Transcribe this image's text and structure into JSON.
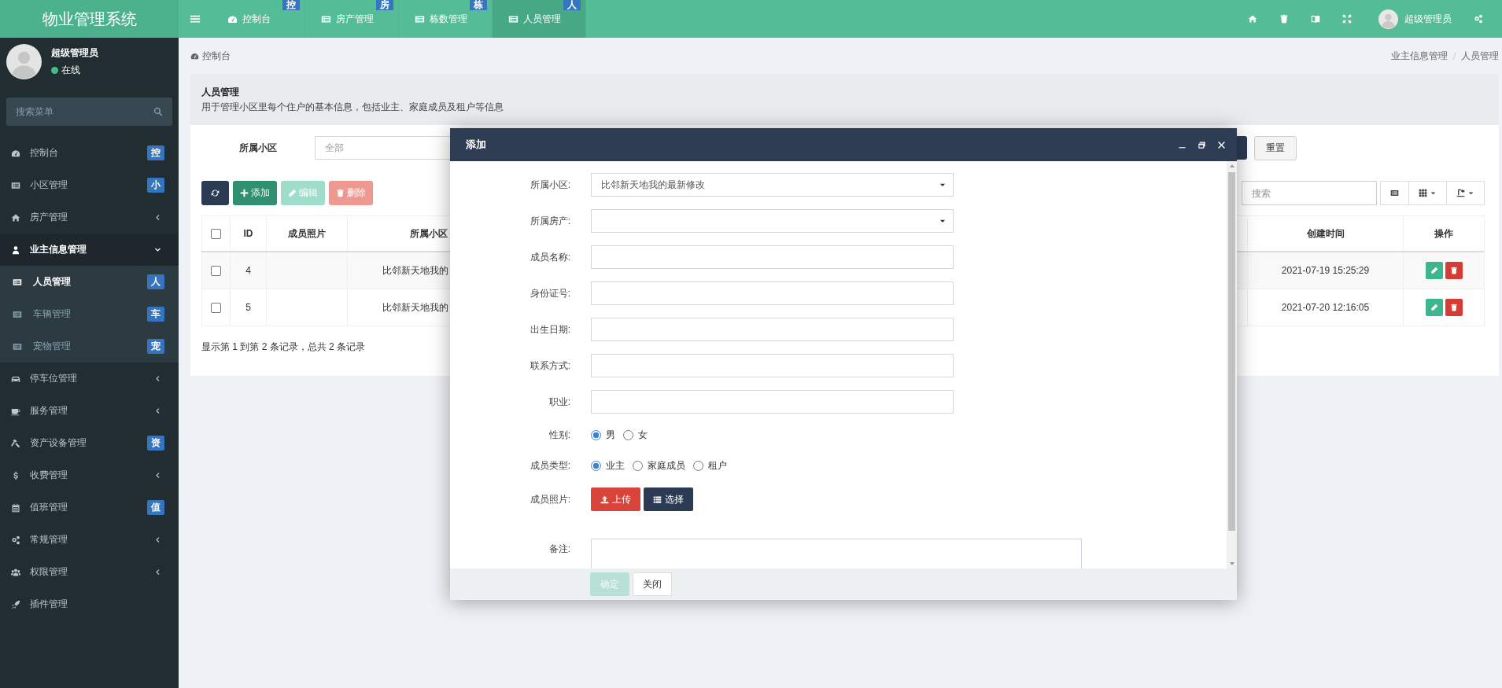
{
  "header": {
    "app_title": "物业管理系统",
    "tabs": [
      {
        "label": "控制台",
        "badge": "控",
        "selected": false
      },
      {
        "label": "房产管理",
        "badge": "房",
        "selected": false
      },
      {
        "label": "栋数管理",
        "badge": "栋",
        "selected": false
      },
      {
        "label": "人员管理",
        "badge": "人",
        "selected": true
      }
    ],
    "user_name": "超级管理员"
  },
  "sidebar": {
    "user": {
      "name": "超级管理员",
      "status": "在线"
    },
    "search": {
      "placeholder": "搜索菜单"
    },
    "items": [
      {
        "label": "控制台",
        "kind": "badge",
        "badge": "控",
        "selected": false
      },
      {
        "label": "小区管理",
        "kind": "badge",
        "badge": "小",
        "selected": false
      },
      {
        "label": "房产管理",
        "kind": "submenu",
        "expanded": false,
        "selected": false
      },
      {
        "label": "业主信息管理",
        "kind": "submenu",
        "expanded": true,
        "selected": false,
        "children": [
          {
            "label": "人员管理",
            "badge": "人",
            "selected": true
          },
          {
            "label": "车辆管理",
            "badge": "车",
            "selected": false
          },
          {
            "label": "宠物管理",
            "badge": "宠",
            "selected": false
          }
        ]
      },
      {
        "label": "停车位管理",
        "kind": "submenu",
        "expanded": false,
        "selected": false
      },
      {
        "label": "服务管理",
        "kind": "submenu",
        "expanded": false,
        "selected": false
      },
      {
        "label": "资产设备管理",
        "kind": "badge",
        "badge": "资",
        "selected": false
      },
      {
        "label": "收费管理",
        "kind": "submenu",
        "expanded": false,
        "selected": false
      },
      {
        "label": "值班管理",
        "kind": "badge",
        "badge": "值",
        "selected": false
      },
      {
        "label": "常规管理",
        "kind": "submenu",
        "expanded": false,
        "selected": false
      },
      {
        "label": "权限管理",
        "kind": "submenu",
        "expanded": false,
        "selected": false
      },
      {
        "label": "插件管理",
        "kind": "plain",
        "selected": false
      }
    ]
  },
  "breadcrumb_home": "控制台",
  "breadcrumb": [
    "业主信息管理",
    "人员管理"
  ],
  "page": {
    "title": "人员管理",
    "description": "用于管理小区里每个住户的基本信息，包括业主、家庭成员及租户等信息"
  },
  "filter": {
    "label": "所属小区",
    "placeholder": "全部",
    "reset_button": "重置"
  },
  "toolbar": {
    "buttons": [
      {
        "kind": "refresh",
        "disabled": false
      },
      {
        "kind": "add",
        "label": "添加",
        "disabled": false
      },
      {
        "kind": "edit",
        "label": "编辑",
        "disabled": true
      },
      {
        "kind": "delete",
        "label": "删除",
        "disabled": true
      }
    ],
    "search_placeholder": "搜索"
  },
  "table": {
    "columns": [
      "ID",
      "成员照片",
      "所属小区",
      "创建时间",
      "操作"
    ],
    "rows": [
      {
        "checked": false,
        "id": "4",
        "community": "比邻新天地我的",
        "created_at": "2021-07-19 15:25:29"
      },
      {
        "checked": false,
        "id": "5",
        "community": "比邻新天地我的",
        "created_at": "2021-07-20 12:16:05"
      }
    ],
    "select_all_checked": false,
    "summary": "显示第 1 到第 2 条记录，总共 2 条记录"
  },
  "dialog": {
    "title": "添加",
    "fields": [
      {
        "kind": "select",
        "label": "所属小区:",
        "value": "比邻新天地我的最新修改"
      },
      {
        "kind": "select",
        "label": "所属房产:"
      },
      {
        "kind": "text",
        "label": "成员名称:"
      },
      {
        "kind": "text",
        "label": "身份证号:"
      },
      {
        "kind": "text",
        "label": "出生日期:"
      },
      {
        "kind": "text",
        "label": "联系方式:"
      },
      {
        "kind": "text",
        "label": "职业:"
      },
      {
        "kind": "radio",
        "label": "性别:",
        "options": [
          {
            "label": "男",
            "selected": true
          },
          {
            "label": "女",
            "selected": false
          }
        ]
      },
      {
        "kind": "radio",
        "label": "成员类型:",
        "options": [
          {
            "label": "业主",
            "selected": true
          },
          {
            "label": "家庭成员",
            "selected": false
          },
          {
            "label": "租户",
            "selected": false
          }
        ]
      },
      {
        "kind": "upload",
        "label": "成员照片:",
        "buttons": [
          "上传",
          "选择"
        ]
      },
      {
        "kind": "textarea",
        "label": "备注:"
      }
    ],
    "buttons": [
      {
        "kind": "primary",
        "label": "确定",
        "disabled": true
      },
      {
        "kind": "default",
        "label": "关闭",
        "disabled": false
      }
    ]
  }
}
